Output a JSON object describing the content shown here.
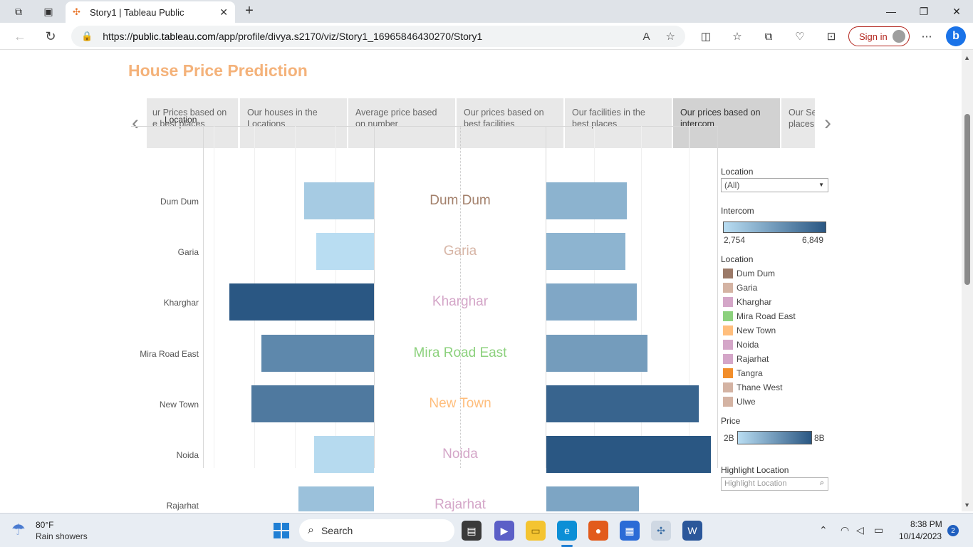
{
  "browser": {
    "tab_title": "Story1 | Tableau Public",
    "url_prefix": "https://",
    "url_host": "public.tableau.com",
    "url_path": "/app/profile/divya.s2170/viz/Story1_16965846430270/Story1",
    "signin_label": "Sign in",
    "bing_label": "b"
  },
  "story": {
    "title": "House Price Prediction",
    "points": [
      {
        "label_line1": "ur Prices based on",
        "label_line2": "e best places",
        "active": false
      },
      {
        "label_line1": "Our houses in the",
        "label_line2": "Locations",
        "active": false
      },
      {
        "label_line1": "Average price based",
        "label_line2": "on number",
        "active": false
      },
      {
        "label_line1": "Our prices based on",
        "label_line2": "best facilities",
        "active": false
      },
      {
        "label_line1": "Our facilities in the",
        "label_line2": "best places",
        "active": false
      },
      {
        "label_line1": "Our prices based on",
        "label_line2": "intercom",
        "active": true
      },
      {
        "label_line1": "Our Se",
        "label_line2": "places",
        "active": false
      }
    ]
  },
  "viz": {
    "location_header": "Location",
    "rows": [
      {
        "location": "Dum Dum",
        "label_color": "#a3806b"
      },
      {
        "location": "Garia",
        "label_color": "#d7b5a6"
      },
      {
        "location": "Kharghar",
        "label_color": "#d4a6c8"
      },
      {
        "location": "Mira Road East",
        "label_color": "#8cd17d"
      },
      {
        "location": "New Town",
        "label_color": "#ffbe7d"
      },
      {
        "location": "Noida",
        "label_color": "#d4a6c8"
      },
      {
        "location": "Rajarhat",
        "label_color": "#d4a6c8"
      }
    ]
  },
  "chart_data": {
    "type": "bar",
    "categories": [
      "Dum Dum",
      "Garia",
      "Kharghar",
      "Mira Road East",
      "New Town",
      "Noida",
      "Rajarhat"
    ],
    "series": [
      {
        "name": "Intercom",
        "values": [
          3300,
          2754,
          6849,
          5350,
          5800,
          2850,
          3600
        ],
        "color_scale": [
          "#b9ddf2",
          "#2a5783"
        ],
        "range": [
          2754,
          6849
        ]
      },
      {
        "name": "Price",
        "values": [
          3.9,
          3.85,
          4.4,
          4.9,
          7.4,
          8.0,
          4.5
        ],
        "color_scale": [
          "#b9ddf2",
          "#2a5783"
        ],
        "range": [
          2,
          8
        ]
      }
    ]
  },
  "legends": {
    "filter_title": "Location",
    "filter_value": "(All)",
    "intercom_title": "Intercom",
    "intercom_min": "2,754",
    "intercom_max": "6,849",
    "location_title": "Location",
    "location_items": [
      {
        "label": "Dum Dum",
        "color": "#9c7a68"
      },
      {
        "label": "Garia",
        "color": "#d4b3a3"
      },
      {
        "label": "Kharghar",
        "color": "#d4a6c8"
      },
      {
        "label": "Mira Road East",
        "color": "#8cd17d"
      },
      {
        "label": "New Town",
        "color": "#ffbe7d"
      },
      {
        "label": "Noida",
        "color": "#d4a6c8"
      },
      {
        "label": "Rajarhat",
        "color": "#d4a6c8"
      },
      {
        "label": "Tangra",
        "color": "#f28e2b"
      },
      {
        "label": "Thane West",
        "color": "#d4b3a3"
      },
      {
        "label": "Ulwe",
        "color": "#d4b3a3"
      }
    ],
    "price_title": "Price",
    "price_min": "2B",
    "price_max": "8B",
    "highlight_title": "Highlight Location",
    "highlight_placeholder": "Highlight Location"
  },
  "taskbar": {
    "weather_temp": "80°F",
    "weather_desc": "Rain showers",
    "search_label": "Search",
    "time": "8:38 PM",
    "date": "10/14/2023",
    "notification_count": "2"
  }
}
